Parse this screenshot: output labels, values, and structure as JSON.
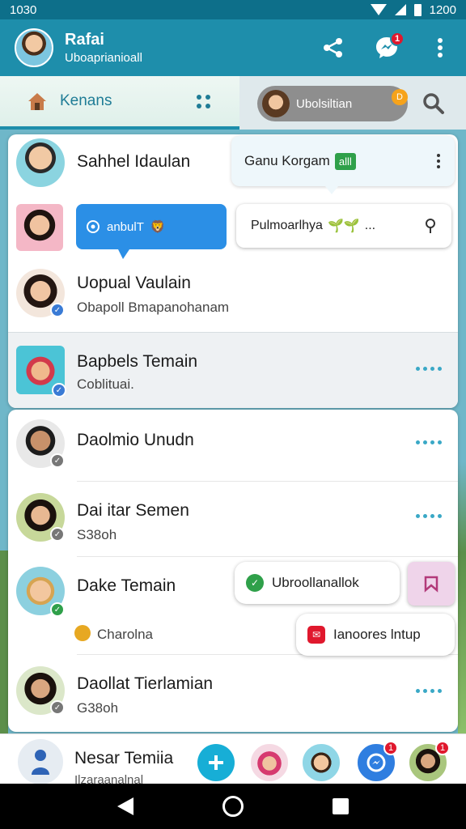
{
  "status_bar": {
    "time_left": "1030",
    "time_right": "1200"
  },
  "app_bar": {
    "title": "Rafai",
    "subtitle": "Uboaprianioall",
    "notification_count": "1"
  },
  "tabs": {
    "home_label": "Kenans",
    "pill_label": "Ubolsiltian",
    "pill_badge": "D"
  },
  "chats": [
    {
      "name": "Sahhel Idaulan",
      "sub": ""
    },
    {
      "name": "",
      "sub": ""
    },
    {
      "name": "Uopual Vaulain",
      "sub": "Obapoll Bmapanohanam"
    },
    {
      "name": "Bapbels Temain",
      "sub": "Coblituai."
    },
    {
      "name": "Daolmio Unudn",
      "sub": ""
    },
    {
      "name": "Dai itar Semen",
      "sub": "S38oh"
    },
    {
      "name": "Dake Temain",
      "sub": "Charolna"
    },
    {
      "name": "Daollat Tierlamian",
      "sub": "G38oh"
    }
  ],
  "bubbles": {
    "top": "Ganu Korgam",
    "top_badge": "alll",
    "blue": "anbulT",
    "gray": "Pulmoarlhya",
    "gray_ellipsis": "..."
  },
  "chips": {
    "green": "Ubroollanallok",
    "red": "Ianoores lntup"
  },
  "dock": {
    "name": "Nesar Temiia",
    "sub": "Ilzaraanalnal",
    "badge_1": "1",
    "badge_2": "1"
  },
  "colors": {
    "header": "#1e8eab",
    "accent": "#3aa8c6",
    "bubble_blue": "#2b8fe6",
    "badge_red": "#e0182d"
  }
}
